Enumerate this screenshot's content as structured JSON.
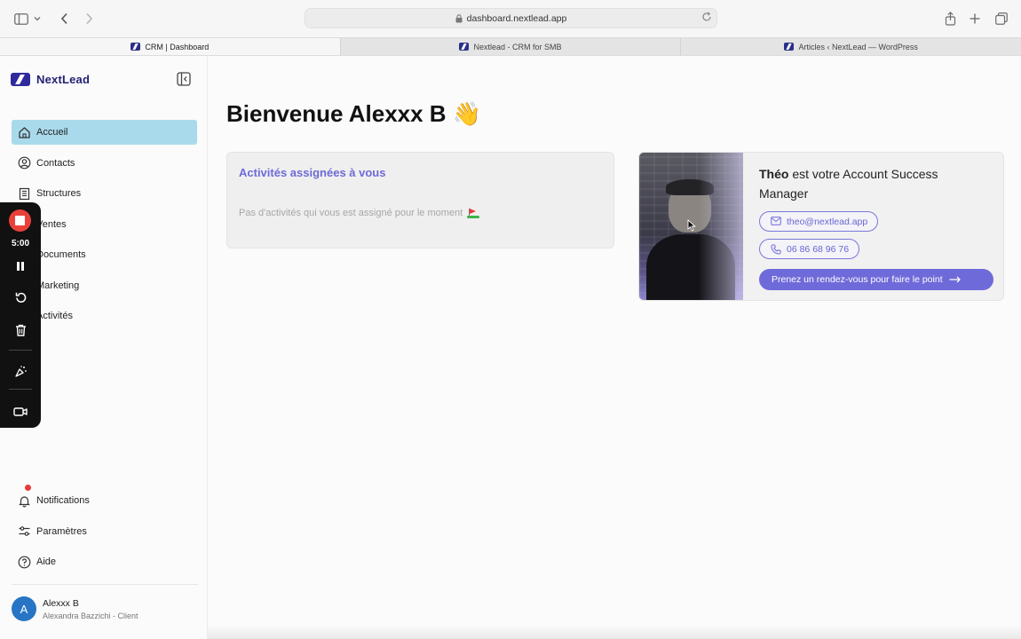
{
  "browser": {
    "url": "dashboard.nextlead.app",
    "tabs": [
      {
        "label": "CRM | Dashboard",
        "active": true
      },
      {
        "label": "Nextlead - CRM for SMB",
        "active": false
      },
      {
        "label": "Articles ‹ NextLead — WordPress",
        "active": false
      }
    ]
  },
  "sidebar": {
    "brand": "NextLead",
    "items": [
      {
        "label": "Accueil",
        "icon": "home-icon",
        "active": true
      },
      {
        "label": "Contacts",
        "icon": "user-circle-icon"
      },
      {
        "label": "Structures",
        "icon": "building-icon"
      },
      {
        "label": "Ventes",
        "icon": "cart-icon"
      },
      {
        "label": "Documents",
        "icon": "document-icon"
      },
      {
        "label": "Marketing",
        "icon": "megaphone-icon"
      },
      {
        "label": "Activités",
        "icon": "checklist-icon"
      }
    ],
    "bottom_items": [
      {
        "label": "Notifications",
        "icon": "bell-icon",
        "has_alert": true
      },
      {
        "label": "Paramètres",
        "icon": "sliders-icon"
      },
      {
        "label": "Aide",
        "icon": "help-icon"
      }
    ],
    "user": {
      "initial": "A",
      "name": "Alexxx B",
      "subtitle": "Alexandra Bazzichi - Client"
    }
  },
  "recorder": {
    "time": "5:00"
  },
  "main": {
    "greeting": "Bienvenue Alexxx B 👋",
    "activities": {
      "title": "Activités assignées à vous",
      "empty": "Pas d'activités qui vous est assigné pour le moment"
    },
    "manager": {
      "name": "Théo",
      "text": " est votre Account Success Manager",
      "email": "theo@nextlead.app",
      "phone": "06 86 68 96 76",
      "cta": "Prenez un rendez-vous pour faire le point"
    }
  },
  "colors": {
    "accent": "#6f6ad9",
    "active_nav": "#a9daec",
    "brand": "#2e2a9c",
    "record": "#e8413a"
  }
}
